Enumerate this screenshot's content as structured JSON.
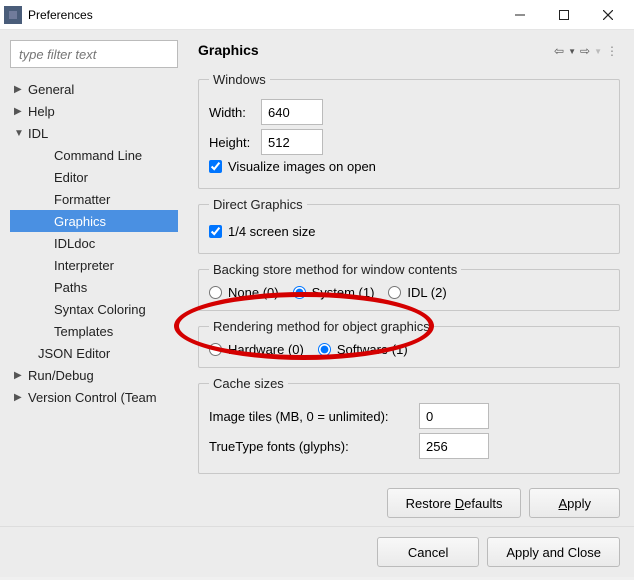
{
  "window": {
    "title": "Preferences"
  },
  "filter": {
    "placeholder": "type filter text"
  },
  "tree": {
    "general": "General",
    "help": "Help",
    "idl": "IDL",
    "cmdline": "Command Line",
    "editor": "Editor",
    "formatter": "Formatter",
    "graphics": "Graphics",
    "idldoc": "IDLdoc",
    "interpreter": "Interpreter",
    "paths": "Paths",
    "syntax": "Syntax Coloring",
    "templates": "Templates",
    "json": "JSON Editor",
    "rundebug": "Run/Debug",
    "vcs": "Version Control (Team"
  },
  "page": {
    "title": "Graphics"
  },
  "windows": {
    "legend": "Windows",
    "width_label": "Width:",
    "width": "640",
    "height_label": "Height:",
    "height": "512",
    "visualize": "Visualize images on open"
  },
  "direct": {
    "legend": "Direct Graphics",
    "quarter": "1/4 screen size"
  },
  "backing": {
    "legend": "Backing store method for window contents",
    "none": "None (0)",
    "system": "System (1)",
    "idl": "IDL (2)"
  },
  "rendering": {
    "legend": "Rendering method for object graphics",
    "hardware": "Hardware (0)",
    "software": "Software (1)"
  },
  "cache": {
    "legend": "Cache sizes",
    "tiles_label": "Image tiles (MB, 0 = unlimited):",
    "tiles": "0",
    "fonts_label": "TrueType fonts (glyphs):",
    "fonts": "256"
  },
  "buttons": {
    "restore": "Restore ",
    "restore_u": "D",
    "restore2": "efaults",
    "apply": "pply",
    "apply_u": "A",
    "cancel": "Cancel",
    "applyclose": "Apply and Close"
  }
}
